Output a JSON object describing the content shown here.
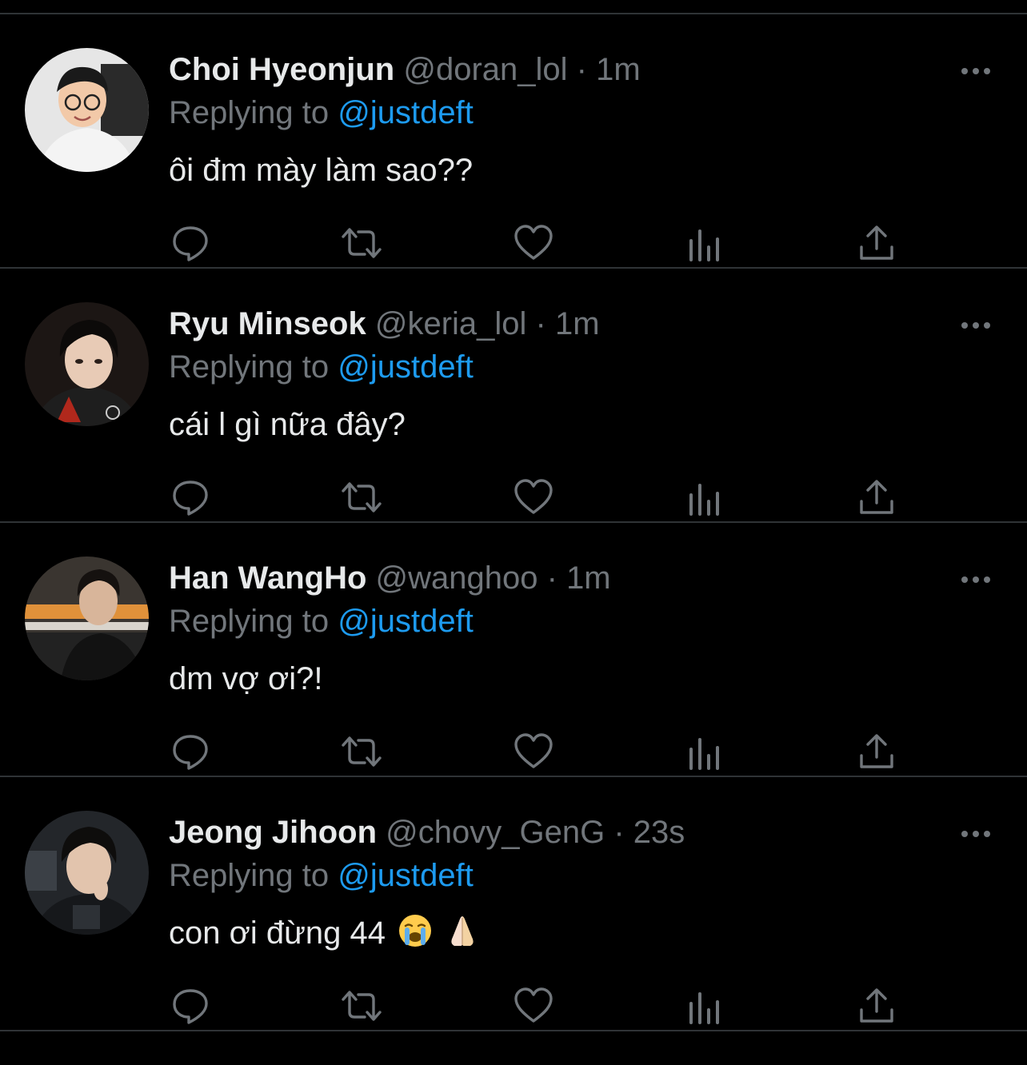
{
  "tweets": [
    {
      "name": "Choi Hyeonjun",
      "handle": "@doran_lol",
      "time": "1m",
      "replying_prefix": "Replying to",
      "replying_to": "@justdeft",
      "text": "ôi đm mày làm sao??"
    },
    {
      "name": "Ryu Minseok",
      "handle": "@keria_lol",
      "time": "1m",
      "replying_prefix": "Replying to",
      "replying_to": "@justdeft",
      "text": "cái l gì nữa đây?"
    },
    {
      "name": "Han WangHo",
      "handle": "@wanghoo",
      "time": "1m",
      "replying_prefix": "Replying to",
      "replying_to": "@justdeft",
      "text": "dm vợ ơi?!"
    },
    {
      "name": "Jeong Jihoon",
      "handle": "@chovy_GenG",
      "time": "23s",
      "replying_prefix": "Replying to",
      "replying_to": "@justdeft",
      "text": "con ơi đừng 44"
    }
  ],
  "separator": "·",
  "icons": {
    "more": "more-dots-icon",
    "reply": "reply-icon",
    "retweet": "retweet-icon",
    "like": "heart-icon",
    "analytics": "analytics-icon",
    "share": "share-icon",
    "emoji_1": "loudly-crying-face-emoji",
    "emoji_2": "folded-hands-emoji"
  },
  "colors": {
    "background": "#000000",
    "text": "#e7e9ea",
    "secondary": "#71767b",
    "link": "#1d9bf0",
    "divider": "#2f3336"
  }
}
